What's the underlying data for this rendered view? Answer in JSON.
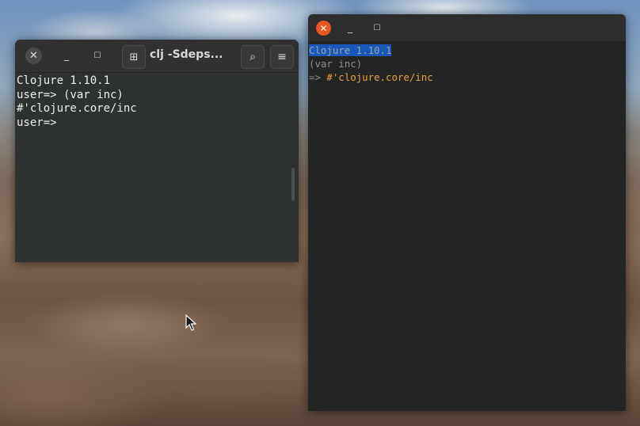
{
  "left_terminal": {
    "title": "clj -Sdeps...",
    "lines": [
      "Clojure 1.10.1",
      "user=> (var inc)",
      "#'clojure.core/inc",
      "user=>"
    ]
  },
  "right_terminal": {
    "line1": "Clojure 1.10.1",
    "line2": "(var inc)",
    "prompt_arrow": "=>",
    "result": "#'clojure.core/inc"
  },
  "icons": {
    "close": "close-icon",
    "minimize": "minimize-icon",
    "maximize": "maximize-icon",
    "new_tab": "new-tab-icon",
    "search": "search-icon",
    "menu": "hamburger-menu-icon"
  },
  "colors": {
    "close_red": "#e95420",
    "selection": "#1a57b8",
    "result_orange": "#e6a23c"
  }
}
